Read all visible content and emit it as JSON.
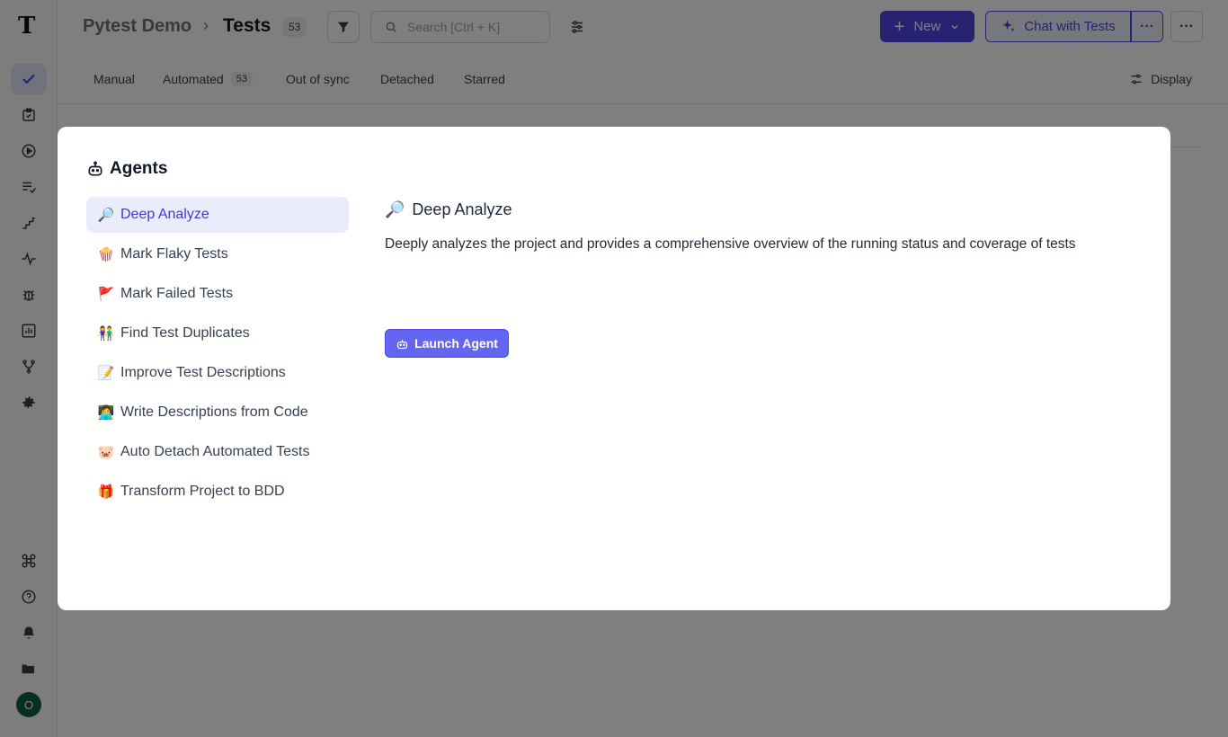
{
  "header": {
    "project": "Pytest Demo",
    "separator": "›",
    "page": "Tests",
    "count": "53",
    "search_placeholder": "Search [Ctrl + K]",
    "new_label": "New",
    "chat_label": "Chat with Tests"
  },
  "tabs": [
    {
      "label": "Manual"
    },
    {
      "label": "Automated",
      "badge": "53"
    },
    {
      "label": "Out of sync"
    },
    {
      "label": "Detached"
    },
    {
      "label": "Starred"
    }
  ],
  "display_label": "Display",
  "user": {
    "initial": "O"
  },
  "modal": {
    "title": "Agents",
    "agents": [
      {
        "emoji": "🔎",
        "label": "Deep Analyze",
        "active": true
      },
      {
        "emoji": "🍿",
        "label": "Mark Flaky Tests"
      },
      {
        "emoji": "🚩",
        "label": "Mark Failed Tests"
      },
      {
        "emoji": "👫",
        "label": "Find Test Duplicates"
      },
      {
        "emoji": "📝",
        "label": "Improve Test Descriptions"
      },
      {
        "emoji": "👩‍💻",
        "label": "Write Descriptions from Code"
      },
      {
        "emoji": "🐷",
        "label": "Auto Detach Automated Tests"
      },
      {
        "emoji": "🎁",
        "label": "Transform Project to BDD"
      }
    ],
    "detail": {
      "emoji": "🔎",
      "title": "Deep Analyze",
      "description": "Deeply analyzes the project and provides a comprehensive overview of the running status and coverage of tests",
      "launch_label": "Launch Agent"
    }
  },
  "colors": {
    "accent": "#4f46e5",
    "launch": "#6366f1",
    "active_bg": "#e8ecfb"
  }
}
